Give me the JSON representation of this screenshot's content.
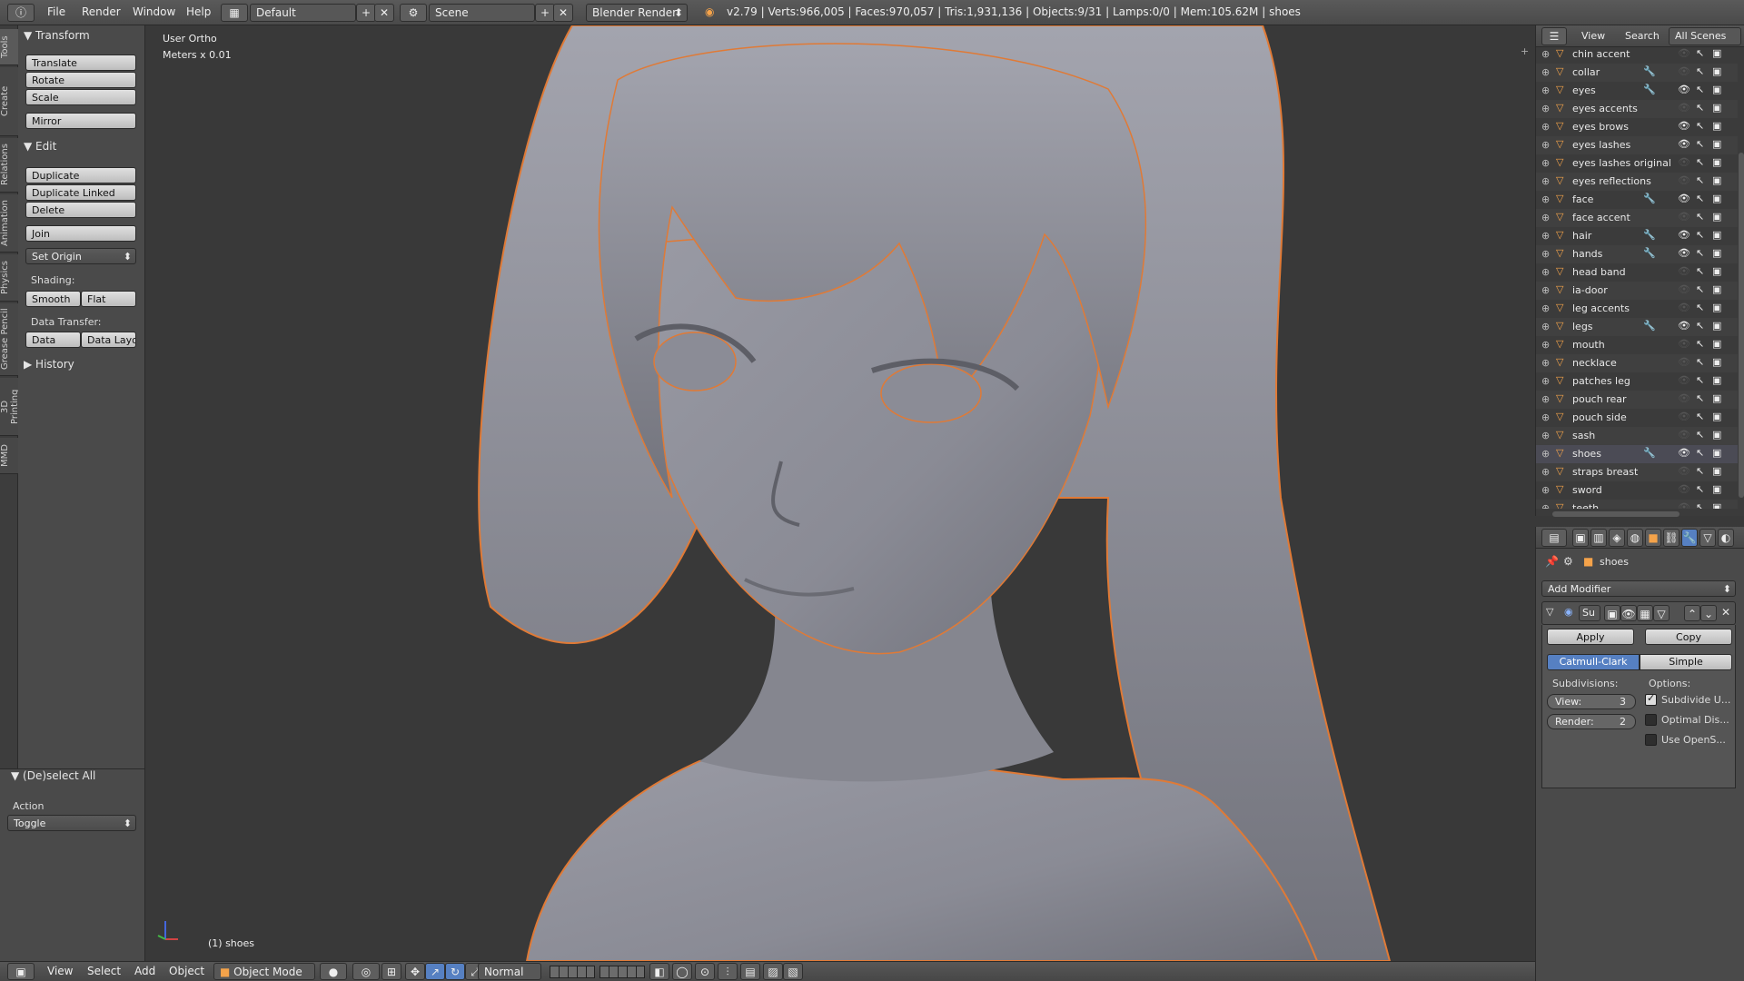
{
  "topbar": {
    "menus": [
      "File",
      "Render",
      "Window",
      "Help"
    ],
    "layout": "Default",
    "scene": "Scene",
    "engine": "Blender Render",
    "stats": "v2.79 | Verts:966,005 | Faces:970,057 | Tris:1,931,136 | Objects:9/31 | Lamps:0/0 | Mem:105.62M | shoes"
  },
  "tool_tabs": [
    "Tools",
    "Create",
    "Relations",
    "Animation",
    "Physics",
    "Grease Pencil",
    "3D Printing",
    "MMD"
  ],
  "shelf": {
    "transform_title": "Transform",
    "translate": "Translate",
    "rotate": "Rotate",
    "scale": "Scale",
    "mirror": "Mirror",
    "edit_title": "Edit",
    "duplicate": "Duplicate",
    "duplicate_linked": "Duplicate Linked",
    "delete": "Delete",
    "join": "Join",
    "set_origin": "Set Origin",
    "shading_label": "Shading:",
    "smooth": "Smooth",
    "flat": "Flat",
    "data_transfer_label": "Data Transfer:",
    "data": "Data",
    "data_layo": "Data Layo",
    "history_title": "History"
  },
  "operator_panel": {
    "title": "(De)select All",
    "action_label": "Action",
    "action_value": "Toggle"
  },
  "viewport": {
    "view_name": "User Ortho",
    "units": "Meters x 0.01",
    "selected_info": "(1) shoes"
  },
  "bottombar": {
    "menus": [
      "View",
      "Select",
      "Add",
      "Object"
    ],
    "mode": "Object Mode",
    "orientation": "Normal"
  },
  "outliner": {
    "menus": [
      "View",
      "Search"
    ],
    "filter": "All Scenes",
    "items": [
      {
        "name": "chin accent",
        "visible": false,
        "mod": false
      },
      {
        "name": "collar",
        "visible": false,
        "mod": true
      },
      {
        "name": "eyes",
        "visible": true,
        "mod": true
      },
      {
        "name": "eyes accents",
        "visible": false,
        "mod": false
      },
      {
        "name": "eyes brows",
        "visible": true,
        "mod": false
      },
      {
        "name": "eyes lashes",
        "visible": true,
        "mod": false
      },
      {
        "name": "eyes lashes original",
        "visible": false,
        "mod": false
      },
      {
        "name": "eyes reflections",
        "visible": false,
        "mod": false
      },
      {
        "name": "face",
        "visible": true,
        "mod": true
      },
      {
        "name": "face accent",
        "visible": false,
        "mod": false
      },
      {
        "name": "hair",
        "visible": true,
        "mod": true
      },
      {
        "name": "hands",
        "visible": true,
        "mod": true
      },
      {
        "name": "head band",
        "visible": false,
        "mod": false
      },
      {
        "name": "ia-door",
        "visible": false,
        "mod": false
      },
      {
        "name": "leg accents",
        "visible": false,
        "mod": false
      },
      {
        "name": "legs",
        "visible": true,
        "mod": true
      },
      {
        "name": "mouth",
        "visible": false,
        "mod": false
      },
      {
        "name": "necklace",
        "visible": false,
        "mod": false
      },
      {
        "name": "patches leg",
        "visible": false,
        "mod": false
      },
      {
        "name": "pouch rear",
        "visible": false,
        "mod": false
      },
      {
        "name": "pouch side",
        "visible": false,
        "mod": false
      },
      {
        "name": "sash",
        "visible": false,
        "mod": false
      },
      {
        "name": "shoes",
        "visible": true,
        "mod": true
      },
      {
        "name": "straps breast",
        "visible": false,
        "mod": false
      },
      {
        "name": "sword",
        "visible": false,
        "mod": false
      },
      {
        "name": "teeth",
        "visible": false,
        "mod": false
      }
    ]
  },
  "properties": {
    "object_name": "shoes",
    "add_modifier": "Add Modifier",
    "modifier_name": "Su",
    "apply": "Apply",
    "copy": "Copy",
    "catmull_clark": "Catmull-Clark",
    "simple": "Simple",
    "subdivisions_label": "Subdivisions:",
    "options_label": "Options:",
    "view_label": "View:",
    "view_value": "3",
    "render_label": "Render:",
    "render_value": "2",
    "opt1": "Subdivide U...",
    "opt1_checked": true,
    "opt2": "Optimal Dis...",
    "opt2_checked": false,
    "opt3": "Use OpenS...",
    "opt3_checked": false
  },
  "colors": {
    "accent_blue": "#5680c2",
    "selection_orange": "#f0833a",
    "mesh_gray": "#8f9099"
  }
}
